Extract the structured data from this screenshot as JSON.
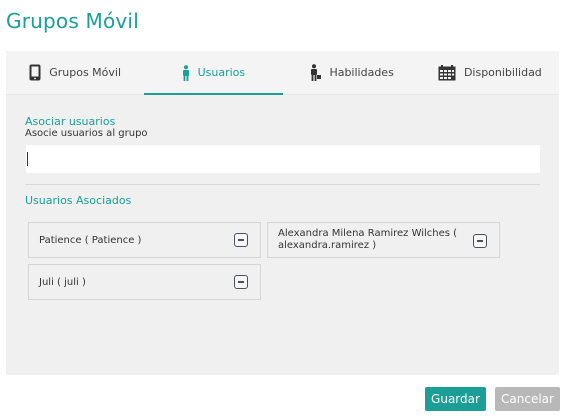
{
  "page": {
    "title": "Grupos Móvil"
  },
  "tabs": [
    {
      "label": "Grupos Móvil",
      "icon": "mobile-phone-icon",
      "active": false
    },
    {
      "label": "Usuarios",
      "icon": "user-icon",
      "active": true
    },
    {
      "label": "Habilidades",
      "icon": "person-with-briefcase-icon",
      "active": false
    },
    {
      "label": "Disponibilidad",
      "icon": "calendar-icon",
      "active": false
    }
  ],
  "associate": {
    "heading": "Asociar usuarios",
    "subheading": "Asocie usuarios al grupo",
    "input_value": ""
  },
  "associated": {
    "heading": "Usuarios Asociados",
    "users": [
      {
        "label": "Patience ( Patience )"
      },
      {
        "label": "Alexandra Milena Ramirez Wilches ( alexandra.ramirez )"
      },
      {
        "label": "Juli ( juli )"
      }
    ]
  },
  "actions": {
    "save": "Guardar",
    "cancel": "Cancelar"
  },
  "colors": {
    "accent": "#1a9e96",
    "panel": "#f0f0f0",
    "cancel": "#b8b8b8"
  }
}
